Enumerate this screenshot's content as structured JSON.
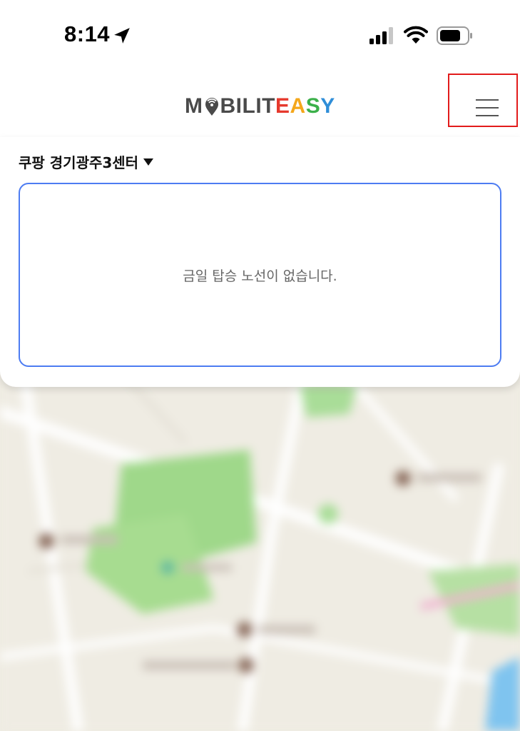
{
  "status_bar": {
    "time": "8:14",
    "icons": [
      "location-arrow-icon",
      "cellular-signal-icon",
      "wifi-icon",
      "battery-icon"
    ]
  },
  "header": {
    "logo": {
      "parts": [
        {
          "text": "M",
          "color": "#4a4a4a"
        },
        {
          "text": "BILIT",
          "color": "#4a4a4a"
        },
        {
          "text": "E",
          "color": "#e6392d"
        },
        {
          "text": "A",
          "color": "#f4a71b"
        },
        {
          "text": "S",
          "color": "#3bb04a"
        },
        {
          "text": "Y",
          "color": "#2f8ed8"
        }
      ],
      "pin_icon": "map-pin-wifi-icon"
    },
    "menu_icon": "hamburger-menu-icon",
    "highlight_color": "#e21b1b"
  },
  "panel": {
    "center_name": "쿠팡 경기광주3센터",
    "dropdown_icon": "caret-down-icon",
    "empty_message": "금일 탑승 노선이 없습니다.",
    "box_border_color": "#4d7cf2"
  },
  "map": {
    "state": "blurred"
  }
}
